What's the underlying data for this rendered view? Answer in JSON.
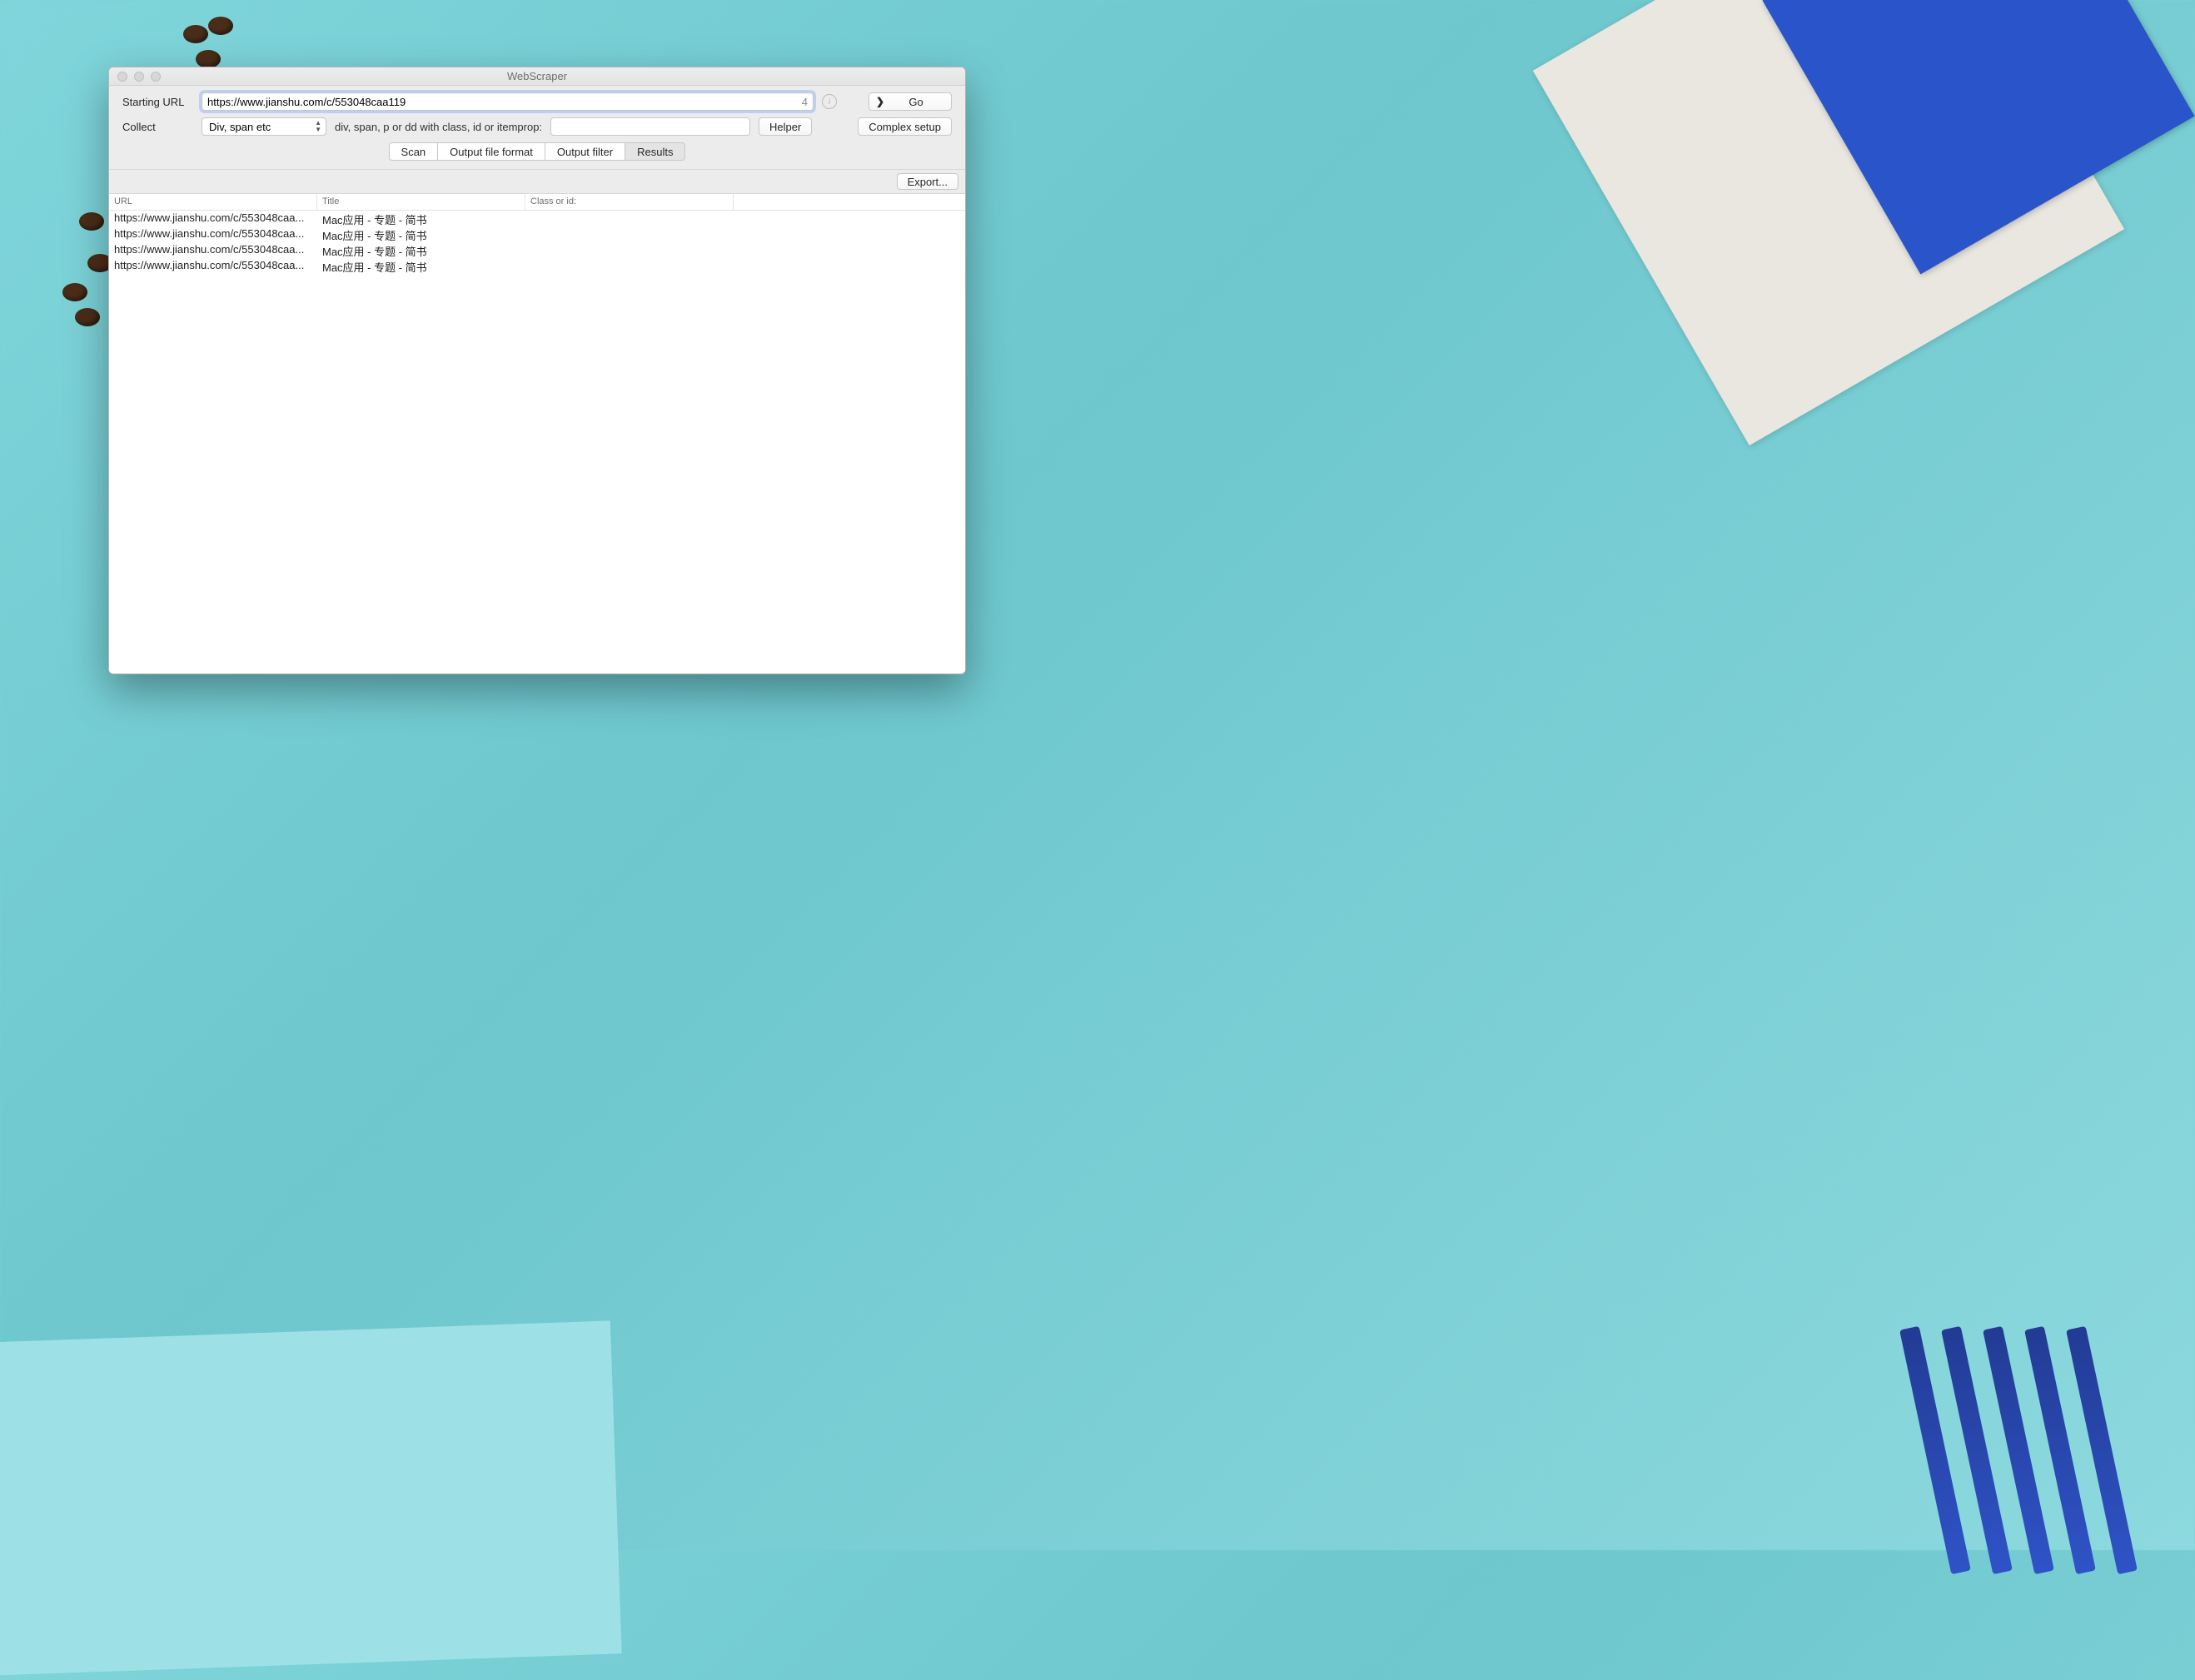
{
  "window": {
    "title": "WebScraper"
  },
  "labels": {
    "starting_url": "Starting URL",
    "collect": "Collect"
  },
  "url_field": {
    "value": "https://www.jianshu.com/c/553048caa119",
    "count": "4"
  },
  "go_button": "Go",
  "collect_select": "Div, span etc",
  "collect_hint": "div, span, p or dd with class, id or itemprop:",
  "class_input_value": "",
  "helper_button": "Helper",
  "complex_button": "Complex setup",
  "tabs": {
    "scan": "Scan",
    "output_format": "Output file format",
    "output_filter": "Output filter",
    "results": "Results"
  },
  "export_button": "Export...",
  "columns": {
    "url": "URL",
    "title": "Title",
    "class": "Class or id:"
  },
  "rows": [
    {
      "url": "https://www.jianshu.com/c/553048caa...",
      "title": "Mac应用 - 专题 - 简书",
      "class": ""
    },
    {
      "url": "https://www.jianshu.com/c/553048caa...",
      "title": "Mac应用 - 专题 - 简书",
      "class": ""
    },
    {
      "url": "https://www.jianshu.com/c/553048caa...",
      "title": "Mac应用 - 专题 - 简书",
      "class": ""
    },
    {
      "url": "https://www.jianshu.com/c/553048caa...",
      "title": "Mac应用 - 专题 - 简书",
      "class": ""
    }
  ]
}
